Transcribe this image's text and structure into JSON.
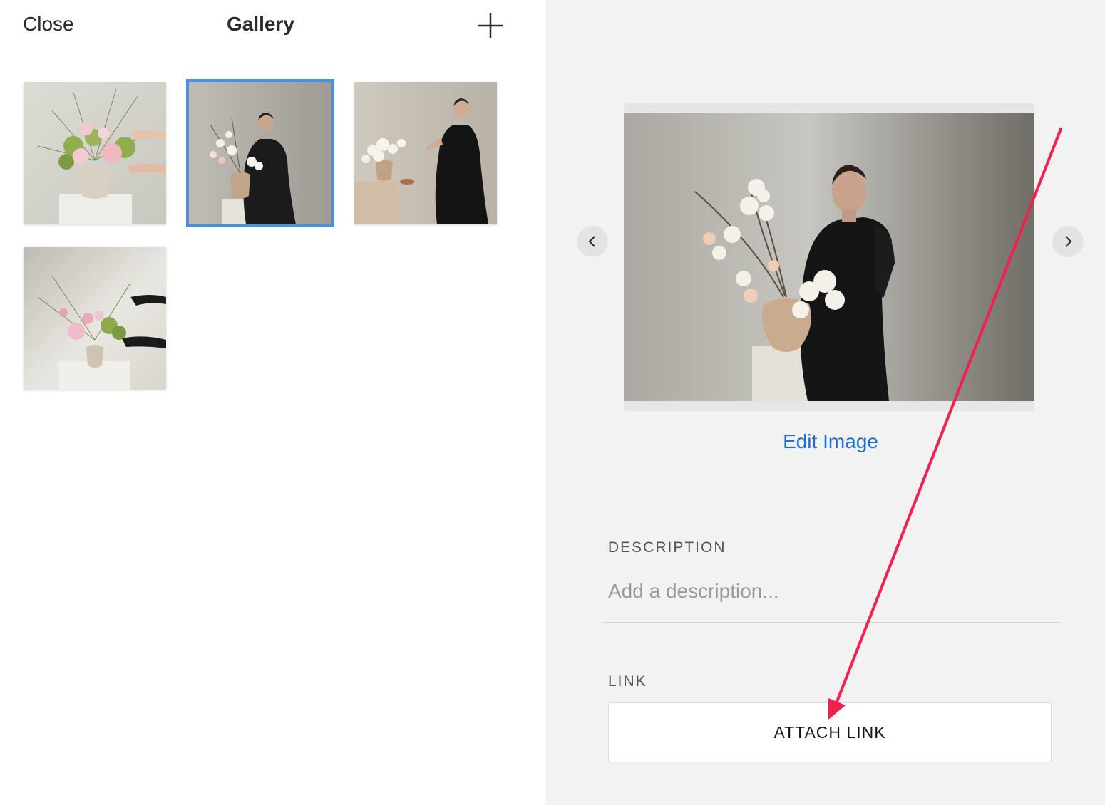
{
  "header": {
    "close_label": "Close",
    "title": "Gallery",
    "add_icon": "plus-icon"
  },
  "gallery": {
    "thumbnails": [
      {
        "subject": "peonies-bouquet",
        "selected": false
      },
      {
        "subject": "woman-arranging-orchids",
        "selected": true
      },
      {
        "subject": "woman-arranging-white-flowers",
        "selected": false
      },
      {
        "subject": "hands-arranging-pink-flowers",
        "selected": false
      }
    ]
  },
  "preview": {
    "prev_icon": "chevron-left-icon",
    "next_icon": "chevron-right-icon",
    "edit_label": "Edit Image"
  },
  "details": {
    "description_label": "DESCRIPTION",
    "description_placeholder": "Add a description...",
    "description_value": "",
    "link_label": "LINK",
    "attach_label": "ATTACH LINK"
  },
  "colors": {
    "accent_blue": "#1e6fd9",
    "selection_outline": "#4a90e2",
    "annotation_arrow": "#f0204f",
    "right_panel_bg": "#f2f2f2"
  }
}
